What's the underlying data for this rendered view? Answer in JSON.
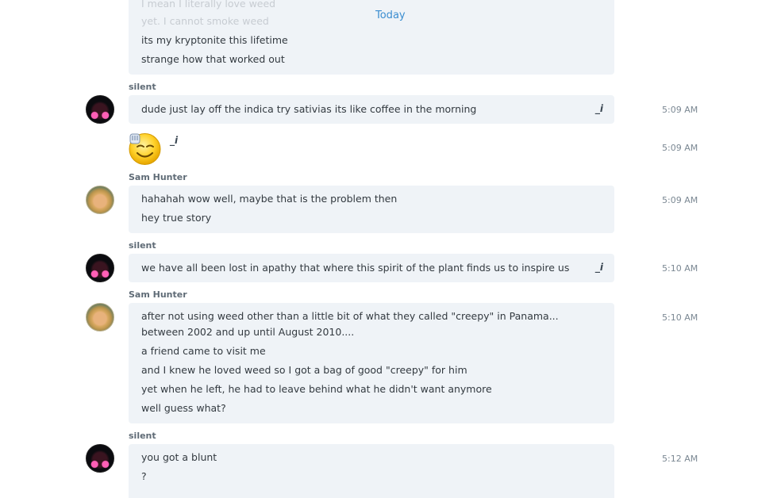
{
  "divider_label": "Today",
  "edit_marker": "_i",
  "messages": {
    "m0": {
      "lines": [
        "I mean I literally love weed",
        "yet. I cannot smoke weed",
        "its my kryptonite this lifetime",
        "strange how that worked out"
      ]
    },
    "m1": {
      "sender": "silent",
      "lines": [
        "dude just lay off the indica   try sativias  its like coffee in the morning"
      ],
      "time": "5:09 AM"
    },
    "m2": {
      "emoji": "rock-on-grin-emoticon",
      "time": "5:09 AM"
    },
    "m3": {
      "sender": "Sam Hunter",
      "lines": [
        "hahahah wow well, maybe that is the problem then",
        "hey  true story"
      ],
      "time": "5:09 AM"
    },
    "m4": {
      "sender": "silent",
      "lines": [
        "we have all been lost in apathy that where this spirit of the plant finds us  to inspire us"
      ],
      "time": "5:10 AM"
    },
    "m5": {
      "sender": "Sam Hunter",
      "lines": [
        "after not using weed other than a little bit of what they called \"creepy\" in Panama... between 2002 and up until August 2010....",
        "a friend came to visit me",
        "and I knew he loved weed so I got a bag of good \"creepy\" for him",
        "yet when he left, he had to leave behind what he didn't want anymore",
        "well guess what?"
      ],
      "time": "5:10 AM"
    },
    "m6": {
      "sender": "silent",
      "lines": [
        "you got a blunt",
        "?"
      ],
      "time": "5:12 AM"
    }
  },
  "colors": {
    "bubble": "#eff3f7",
    "divider": "#3a8dd0",
    "time": "#7b8893",
    "sender": "#5f6b76"
  }
}
